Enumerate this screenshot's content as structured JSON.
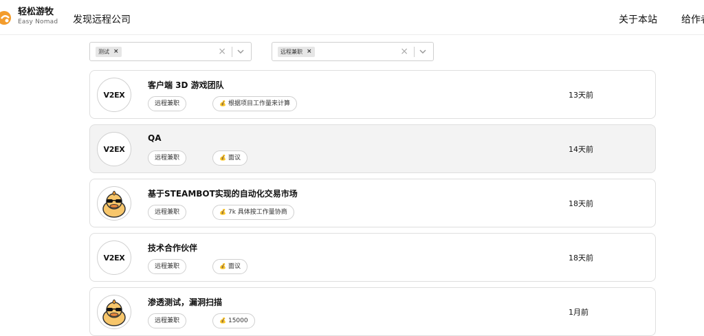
{
  "header": {
    "brand_title": "轻松游牧",
    "brand_subtitle": "Easy Nomad",
    "nav_main": "发现远程公司",
    "nav_about": "关于本站",
    "nav_write": "给作者"
  },
  "filters": [
    {
      "chip": "测试",
      "chip_remove": "×",
      "clear": "×"
    },
    {
      "chip": "远程兼职",
      "chip_remove": "×",
      "clear": "×"
    }
  ],
  "jobs": [
    {
      "logo": "V2EX",
      "title": "客户端 3D 游戏团队",
      "type": "远程兼职",
      "pay": "根据项目工作量来计算",
      "time": "13天前"
    },
    {
      "logo": "V2EX",
      "title": "QA",
      "type": "远程兼职",
      "pay": "面议",
      "time": "14天前"
    },
    {
      "logo": "duck",
      "title": "基于STEAMBOT实现的自动化交易市场",
      "type": "远程兼职",
      "pay": "7k 具体按工作量协商",
      "time": "18天前"
    },
    {
      "logo": "V2EX",
      "title": "技术合作伙伴",
      "type": "远程兼职",
      "pay": "面议",
      "time": "18天前"
    },
    {
      "logo": "duck",
      "title": "渗透测试，漏洞扫描",
      "type": "远程兼职",
      "pay": "15000",
      "time": "1月前"
    }
  ],
  "colors": {
    "brand_orange": "#f39c2c",
    "border": "#dedede",
    "highlight_row": "#f3f3f3"
  }
}
